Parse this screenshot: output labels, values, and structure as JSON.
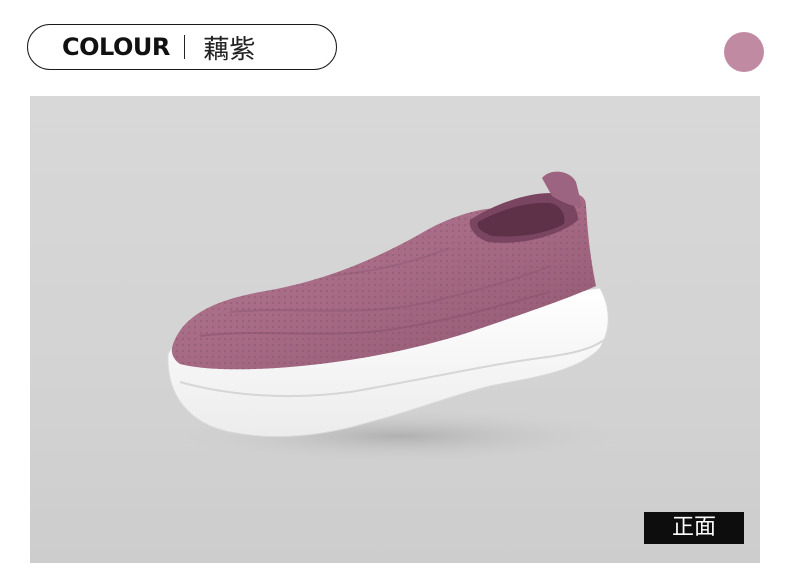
{
  "header": {
    "colour_label": "COLOUR",
    "colour_name": "藕紫"
  },
  "swatch": {
    "color": "#c08ba2"
  },
  "photo": {
    "view_tag": "正面",
    "shoe_color": "#a86a86",
    "sole_color": "#ffffff"
  }
}
